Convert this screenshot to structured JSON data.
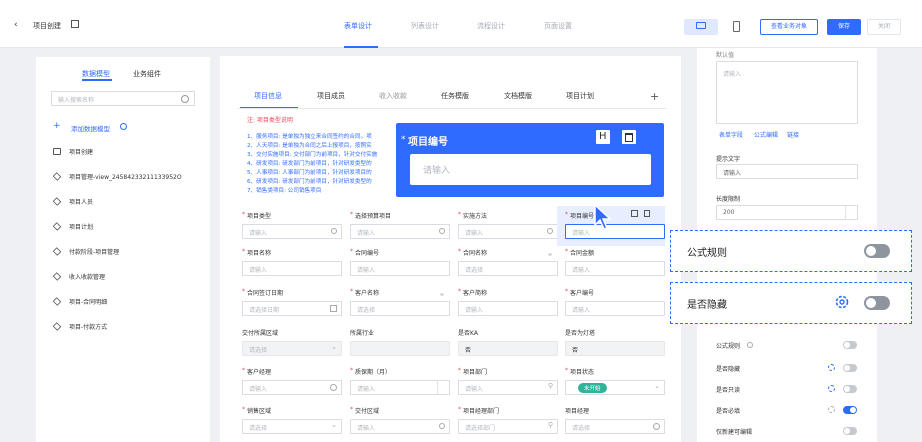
{
  "header": {
    "back_icon": "chevron-left-icon",
    "title": "项目创建",
    "edit_icon": "edit-icon",
    "tabs": [
      "表单设计",
      "列表设计",
      "流程设计",
      "页面设置"
    ],
    "view_business_btn": "查看业务对象",
    "save_btn": "保存",
    "close_btn": "关闭"
  },
  "left": {
    "tabs": [
      "数据模型",
      "业务组件"
    ],
    "search_placeholder": "输入搜索名称",
    "add_model": "添加数据模型",
    "items": [
      "项目创建",
      "项目管理-view_24584233211133952O",
      "项目人员",
      "项目计划",
      "付款阶段-项目管理",
      "收入收款管理",
      "项目-合同明细",
      "项目-付款方式"
    ]
  },
  "form": {
    "tabs": [
      "项目信息",
      "项目成员",
      "收入收款",
      "任务模版",
      "文档模版",
      "项目计划"
    ],
    "note_title": "注: 项目类型说明",
    "notes": [
      "1、服务项目: 是单独为独立来合同签约的合同。项",
      "2、人天项目: 是单独为合同之后上报项目，按照实",
      "3、交付实施项目: 交付部门为前项目，针对交付实施",
      "4、研发项目: 研发部门为前项目，针对研发类型的",
      "5、人事项目: 人事部门为前项目，针对研发项目的",
      "6、研发项目: 研发部门为前项目，针对研发类型的",
      "7、销售类项目: 公司销售项目"
    ],
    "rows": [
      [
        {
          "label": "项目类型",
          "req": true,
          "ph": "请输入",
          "icon": "search"
        },
        {
          "label": "选择预算项目",
          "req": true,
          "ph": "请输入",
          "icon": "search"
        },
        {
          "label": "实施方法",
          "req": true,
          "ph": "请输入",
          "icon": "search"
        },
        {
          "label": "项目编号",
          "req": true,
          "ph": "请输入",
          "icon": ""
        }
      ],
      [
        {
          "label": "项目名称",
          "req": true,
          "ph": "请输入",
          "icon": ""
        },
        {
          "label": "合同编号",
          "req": true,
          "ph": "请输入",
          "icon": ""
        },
        {
          "label": "合同名称",
          "req": true,
          "ph": "请选择",
          "icon": "link"
        },
        {
          "label": "合同金额",
          "req": true,
          "ph": "请输入",
          "icon": ""
        }
      ],
      [
        {
          "label": "合同签订日期",
          "req": true,
          "ph": "请选择日期",
          "icon": "calendar"
        },
        {
          "label": "客户名称",
          "req": true,
          "ph": "请选择",
          "icon": "link"
        },
        {
          "label": "客户简称",
          "req": true,
          "ph": "请输入",
          "icon": ""
        },
        {
          "label": "客户编号",
          "req": true,
          "ph": "请输入",
          "icon": ""
        }
      ],
      [
        {
          "label": "交付所属区域",
          "req": false,
          "ph": "请选择",
          "icon": "select",
          "fill": true
        },
        {
          "label": "所属行业",
          "req": false,
          "ph": "",
          "icon": "",
          "fill": true
        },
        {
          "label": "是否KA",
          "req": false,
          "ph": "否",
          "icon": "",
          "fill": true
        },
        {
          "label": "是否为灯塔",
          "req": false,
          "ph": "否",
          "icon": "",
          "fill": true
        }
      ],
      [
        {
          "label": "客户经理",
          "req": true,
          "ph": "请输入",
          "icon": "user"
        },
        {
          "label": "质保期（月）",
          "req": true,
          "ph": "请输入",
          "icon": "stepper"
        },
        {
          "label": "项目部门",
          "req": true,
          "ph": "请输入",
          "icon": "org"
        },
        {
          "label": "项目状态",
          "req": true,
          "ph": "",
          "icon": "select",
          "status": "未开始"
        }
      ],
      [
        {
          "label": "销售区域",
          "req": true,
          "ph": "请选择",
          "icon": "select"
        },
        {
          "label": "交付区域",
          "req": true,
          "ph": "请输入",
          "icon": "search"
        },
        {
          "label": "项目经理部门",
          "req": true,
          "ph": "请选择部门",
          "icon": "org"
        },
        {
          "label": "项目经理",
          "req": false,
          "ph": "请选择",
          "icon": "user"
        }
      ]
    ]
  },
  "popup": {
    "title": "项目编号",
    "placeholder": "请输入",
    "h_icon": "H",
    "delete_icon": "trash-icon"
  },
  "right": {
    "label_textarea": "默认值",
    "textarea_ph": "请输入",
    "links": [
      "表单字段",
      "公式编辑",
      "链接"
    ],
    "prompt_label": "提示文字",
    "prompt_value": "请输入",
    "length_label": "长度限制",
    "length_value": "200",
    "formula_rule": "公式规则",
    "is_hidden": "是否隐藏",
    "small": [
      {
        "label": "公式规则",
        "gear": false,
        "on": false
      },
      {
        "label": "是否隐藏",
        "gear": true,
        "on": false
      },
      {
        "label": "是否只读",
        "gear": true,
        "on": false
      },
      {
        "label": "是否必填",
        "gear": true,
        "on": true
      },
      {
        "label": "仅新建可编辑",
        "gear": false,
        "on": false
      }
    ]
  }
}
